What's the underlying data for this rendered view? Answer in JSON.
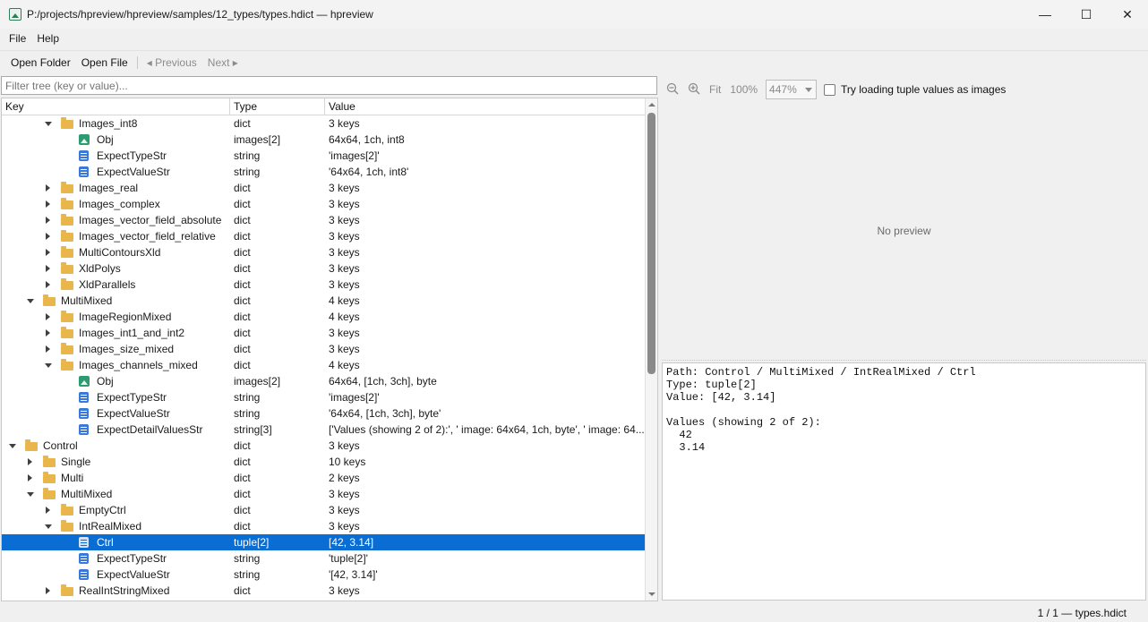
{
  "window": {
    "title": "P:/projects/hpreview/hpreview/samples/12_types/types.hdict — hpreview",
    "minimize": "—",
    "maximize": "☐",
    "close": "✕"
  },
  "menu": {
    "file": "File",
    "help": "Help"
  },
  "toolbar": {
    "open_folder": "Open Folder",
    "open_file": "Open File",
    "previous": "◂ Previous",
    "next": "Next ▸"
  },
  "filter": {
    "placeholder": "Filter tree (key or value)..."
  },
  "tree": {
    "headers": {
      "key": "Key",
      "type": "Type",
      "value": "Value"
    },
    "rows": [
      {
        "depth": 2,
        "arrow": "open",
        "icon": "folder",
        "key": "Images_int8",
        "type": "dict",
        "value": "3 keys"
      },
      {
        "depth": 3,
        "arrow": "",
        "icon": "image",
        "key": "Obj",
        "type": "images[2]",
        "value": "64x64, 1ch, int8"
      },
      {
        "depth": 3,
        "arrow": "",
        "icon": "string",
        "key": "ExpectTypeStr",
        "type": "string",
        "value": "'images[2]'"
      },
      {
        "depth": 3,
        "arrow": "",
        "icon": "string",
        "key": "ExpectValueStr",
        "type": "string",
        "value": "'64x64, 1ch, int8'"
      },
      {
        "depth": 2,
        "arrow": "closed",
        "icon": "folder",
        "key": "Images_real",
        "type": "dict",
        "value": "3 keys"
      },
      {
        "depth": 2,
        "arrow": "closed",
        "icon": "folder",
        "key": "Images_complex",
        "type": "dict",
        "value": "3 keys"
      },
      {
        "depth": 2,
        "arrow": "closed",
        "icon": "folder",
        "key": "Images_vector_field_absolute",
        "type": "dict",
        "value": "3 keys"
      },
      {
        "depth": 2,
        "arrow": "closed",
        "icon": "folder",
        "key": "Images_vector_field_relative",
        "type": "dict",
        "value": "3 keys"
      },
      {
        "depth": 2,
        "arrow": "closed",
        "icon": "folder",
        "key": "MultiContoursXld",
        "type": "dict",
        "value": "3 keys"
      },
      {
        "depth": 2,
        "arrow": "closed",
        "icon": "folder",
        "key": "XldPolys",
        "type": "dict",
        "value": "3 keys"
      },
      {
        "depth": 2,
        "arrow": "closed",
        "icon": "folder",
        "key": "XldParallels",
        "type": "dict",
        "value": "3 keys"
      },
      {
        "depth": 1,
        "arrow": "open",
        "icon": "folder",
        "key": "MultiMixed",
        "type": "dict",
        "value": "4 keys"
      },
      {
        "depth": 2,
        "arrow": "closed",
        "icon": "folder",
        "key": "ImageRegionMixed",
        "type": "dict",
        "value": "4 keys"
      },
      {
        "depth": 2,
        "arrow": "closed",
        "icon": "folder",
        "key": "Images_int1_and_int2",
        "type": "dict",
        "value": "3 keys"
      },
      {
        "depth": 2,
        "arrow": "closed",
        "icon": "folder",
        "key": "Images_size_mixed",
        "type": "dict",
        "value": "3 keys"
      },
      {
        "depth": 2,
        "arrow": "open",
        "icon": "folder",
        "key": "Images_channels_mixed",
        "type": "dict",
        "value": "4 keys"
      },
      {
        "depth": 3,
        "arrow": "",
        "icon": "image",
        "key": "Obj",
        "type": "images[2]",
        "value": "64x64, [1ch, 3ch], byte"
      },
      {
        "depth": 3,
        "arrow": "",
        "icon": "string",
        "key": "ExpectTypeStr",
        "type": "string",
        "value": "'images[2]'"
      },
      {
        "depth": 3,
        "arrow": "",
        "icon": "string",
        "key": "ExpectValueStr",
        "type": "string",
        "value": "'64x64, [1ch, 3ch], byte'"
      },
      {
        "depth": 3,
        "arrow": "",
        "icon": "string",
        "key": "ExpectDetailValuesStr",
        "type": "string[3]",
        "value": "['Values (showing 2 of 2):', '  image: 64x64, 1ch, byte', '  image: 64..."
      },
      {
        "depth": 0,
        "arrow": "open",
        "icon": "folder",
        "key": "Control",
        "type": "dict",
        "value": "3 keys"
      },
      {
        "depth": 1,
        "arrow": "closed",
        "icon": "folder",
        "key": "Single",
        "type": "dict",
        "value": "10 keys"
      },
      {
        "depth": 1,
        "arrow": "closed",
        "icon": "folder",
        "key": "Multi",
        "type": "dict",
        "value": "2 keys"
      },
      {
        "depth": 1,
        "arrow": "open",
        "icon": "folder",
        "key": "MultiMixed",
        "type": "dict",
        "value": "3 keys"
      },
      {
        "depth": 2,
        "arrow": "closed",
        "icon": "folder",
        "key": "EmptyCtrl",
        "type": "dict",
        "value": "3 keys"
      },
      {
        "depth": 2,
        "arrow": "open",
        "icon": "folder",
        "key": "IntRealMixed",
        "type": "dict",
        "value": "3 keys"
      },
      {
        "depth": 3,
        "arrow": "",
        "icon": "string",
        "key": "Ctrl",
        "type": "tuple[2]",
        "value": "[42, 3.14]",
        "selected": true
      },
      {
        "depth": 3,
        "arrow": "",
        "icon": "string",
        "key": "ExpectTypeStr",
        "type": "string",
        "value": "'tuple[2]'"
      },
      {
        "depth": 3,
        "arrow": "",
        "icon": "string",
        "key": "ExpectValueStr",
        "type": "string",
        "value": "'[42, 3.14]'"
      },
      {
        "depth": 2,
        "arrow": "closed",
        "icon": "folder",
        "key": "RealIntStringMixed",
        "type": "dict",
        "value": "3 keys"
      }
    ]
  },
  "preview_toolbar": {
    "zoom_out_icon": "zoom-out-icon",
    "zoom_in_icon": "zoom-in-icon",
    "fit": "Fit",
    "hundred": "100%",
    "zoom_value": "447%",
    "try_tuple_images": "Try loading tuple values as images"
  },
  "preview": {
    "empty": "No preview"
  },
  "details": {
    "text": "Path: Control / MultiMixed / IntRealMixed / Ctrl\nType: tuple[2]\nValue: [42, 3.14]\n\nValues (showing 2 of 2):\n  42\n  3.14"
  },
  "status": {
    "text": "1 / 1 — types.hdict"
  },
  "colors": {
    "selection": "#0a6dd4",
    "folder": "#e8b64a",
    "image_icon": "#2e9a6f",
    "string_icon": "#3b78d8"
  }
}
